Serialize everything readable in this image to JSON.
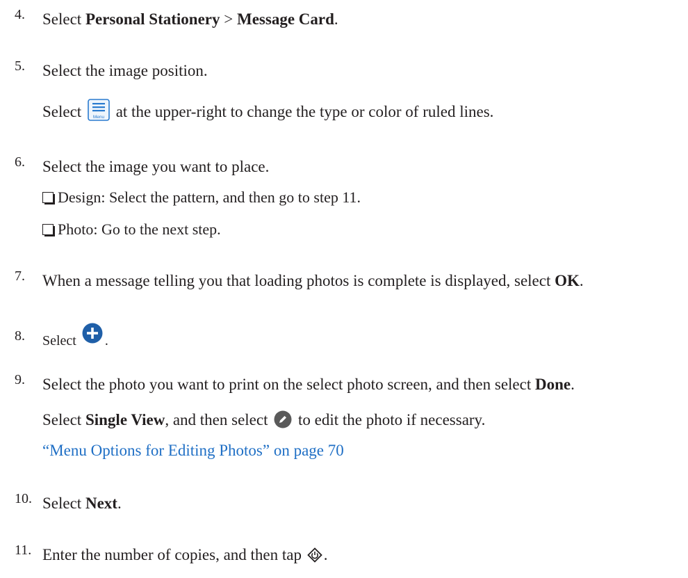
{
  "steps": [
    {
      "num": "4.",
      "pre": "Select ",
      "b1": "Personal Stationery",
      "mid": " > ",
      "b2": "Message Card",
      "post": "."
    },
    {
      "num": "5.",
      "text": "Select the image position.",
      "note_pre": "Select ",
      "note_icon": "menu-icon",
      "note_post": " at the upper-right to change the type or color of ruled lines."
    },
    {
      "num": "6.",
      "text": "Select the image you want to place.",
      "bullets": [
        "Design: Select the pattern, and then go to step 11.",
        "Photo: Go to the next step."
      ]
    },
    {
      "num": "7.",
      "pre": "When a message telling you that loading photos is complete is displayed, select ",
      "b1": "OK",
      "post": "."
    },
    {
      "num": "8.",
      "pre": "Select ",
      "icon": "plus-circle-icon",
      "post": "."
    },
    {
      "num": "9.",
      "pre": "Select the photo you want to print on the select photo screen, and then select ",
      "b1": "Done",
      "post": ".",
      "note_pre": "Select ",
      "note_b": "Single View",
      "note_mid": ", and then select ",
      "note_icon": "edit-icon",
      "note_post": " to edit the photo if necessary.",
      "link": "“Menu Options for Editing Photos” on page 70"
    },
    {
      "num": "10.",
      "pre": "Select ",
      "b1": "Next",
      "post": "."
    },
    {
      "num": "11.",
      "pre": "Enter the number of copies, and then tap ",
      "icon": "start-icon",
      "post": "."
    }
  ],
  "colors": {
    "text": "#231f20",
    "link": "#1f6fc5",
    "icon_blue": "#1f5fa8"
  },
  "menu_icon_label": "Menu"
}
